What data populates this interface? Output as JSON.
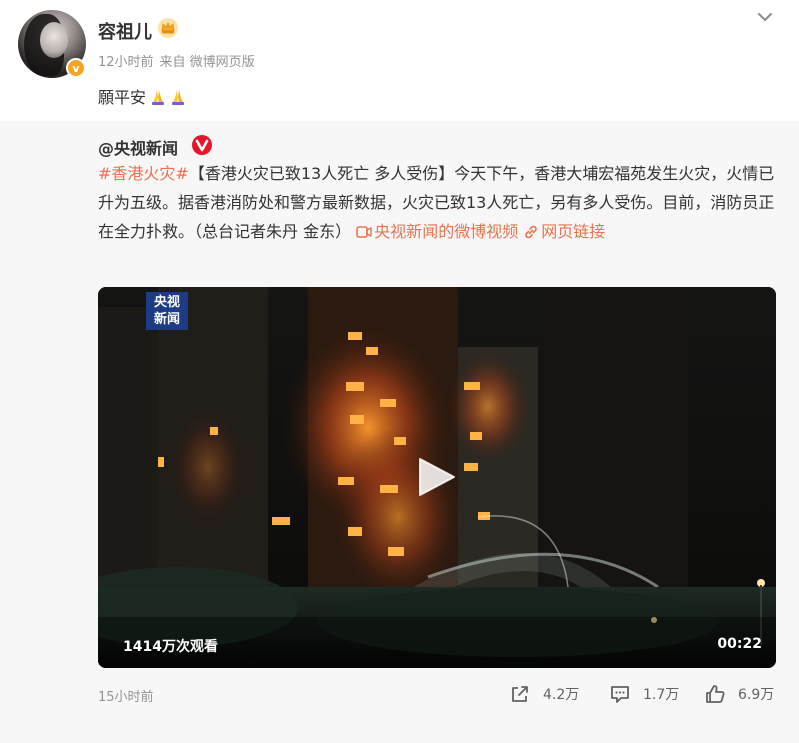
{
  "post": {
    "author": "容祖儿",
    "meta_time": "12小时前",
    "meta_source": "来自 微博网页版",
    "text": "願平安"
  },
  "repost": {
    "author": "@央视新闻",
    "hashtag": "#香港火灾#",
    "body": "【香港火灾已致13人死亡 多人受伤】今天下午，香港大埔宏福苑发生火灾，火情已升为五级。据香港消防处和警方最新数据，火灾已致13人死亡，另有多人受伤。目前，消防员正在全力扑救。（总台记者朱丹 金东）",
    "video_link_label": "央视新闻的微博视频",
    "web_link_label": "网页链接",
    "video": {
      "logo_line1": "央视",
      "logo_line2": "新闻",
      "view_count": "1414万次观看",
      "duration": "00:22"
    },
    "time": "15小时前",
    "actions": {
      "share_count": "4.2万",
      "comment_count": "1.7万",
      "like_count": "6.9万"
    }
  },
  "colors": {
    "link_accent": "#eb7350",
    "verified_orange": "#f4a423",
    "weibo_red": "#e6162d",
    "cctv_blue": "#1e3c86",
    "card_background": "#f7f7f7"
  }
}
